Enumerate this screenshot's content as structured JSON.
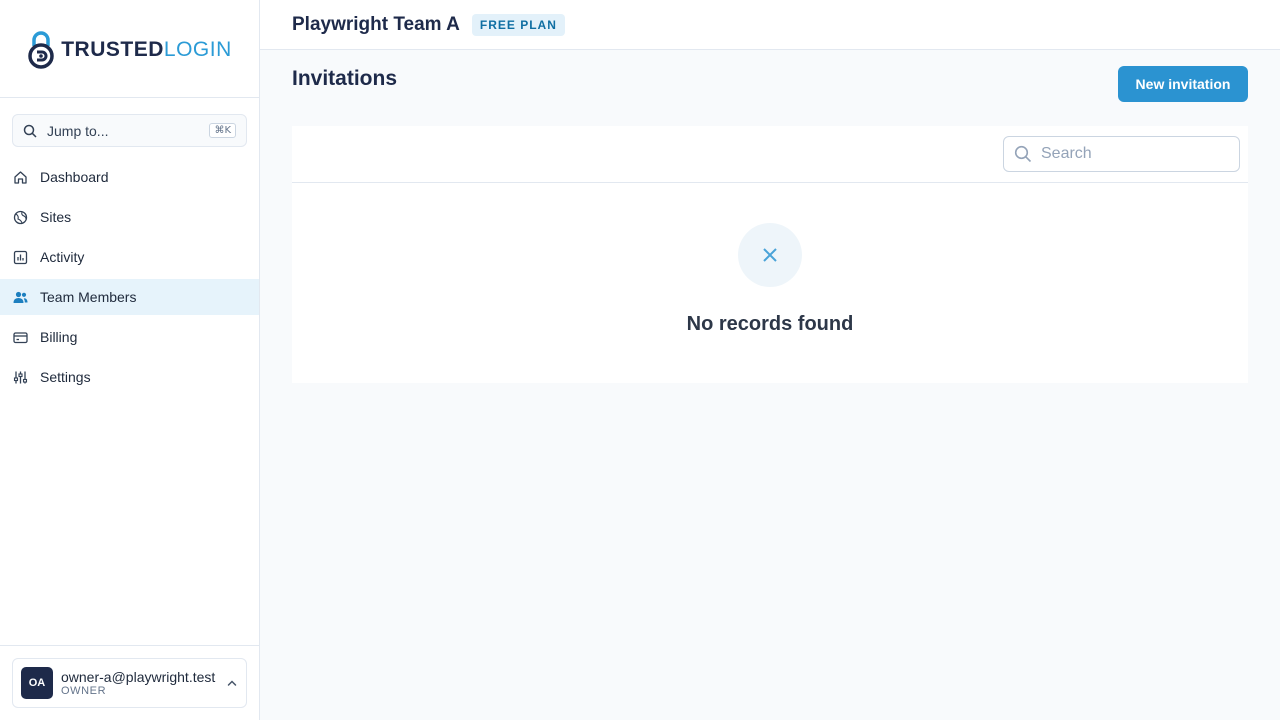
{
  "brand": {
    "logo_part1": "TRUSTED",
    "logo_part2": "LOGIN",
    "primary_color": "#2b93d1",
    "dark_color": "#1e2a4a"
  },
  "sidebar": {
    "jump": {
      "label": "Jump to...",
      "shortcut": "⌘K",
      "icon": "search-icon"
    },
    "items": [
      {
        "label": "Dashboard",
        "icon": "home-icon",
        "active": false
      },
      {
        "label": "Sites",
        "icon": "globe-icon",
        "active": false
      },
      {
        "label": "Activity",
        "icon": "chart-icon",
        "active": false
      },
      {
        "label": "Team Members",
        "icon": "users-icon",
        "active": true
      },
      {
        "label": "Billing",
        "icon": "credit-card-icon",
        "active": false
      },
      {
        "label": "Settings",
        "icon": "sliders-icon",
        "active": false
      }
    ],
    "user": {
      "initials": "OA",
      "email": "owner-a@playwright.test",
      "role": "OWNER"
    }
  },
  "header": {
    "team_name": "Playwright Team A",
    "plan": "FREE PLAN"
  },
  "main": {
    "title": "Invitations",
    "new_button": "New invitation",
    "search_placeholder": "Search",
    "empty_text": "No records found"
  }
}
